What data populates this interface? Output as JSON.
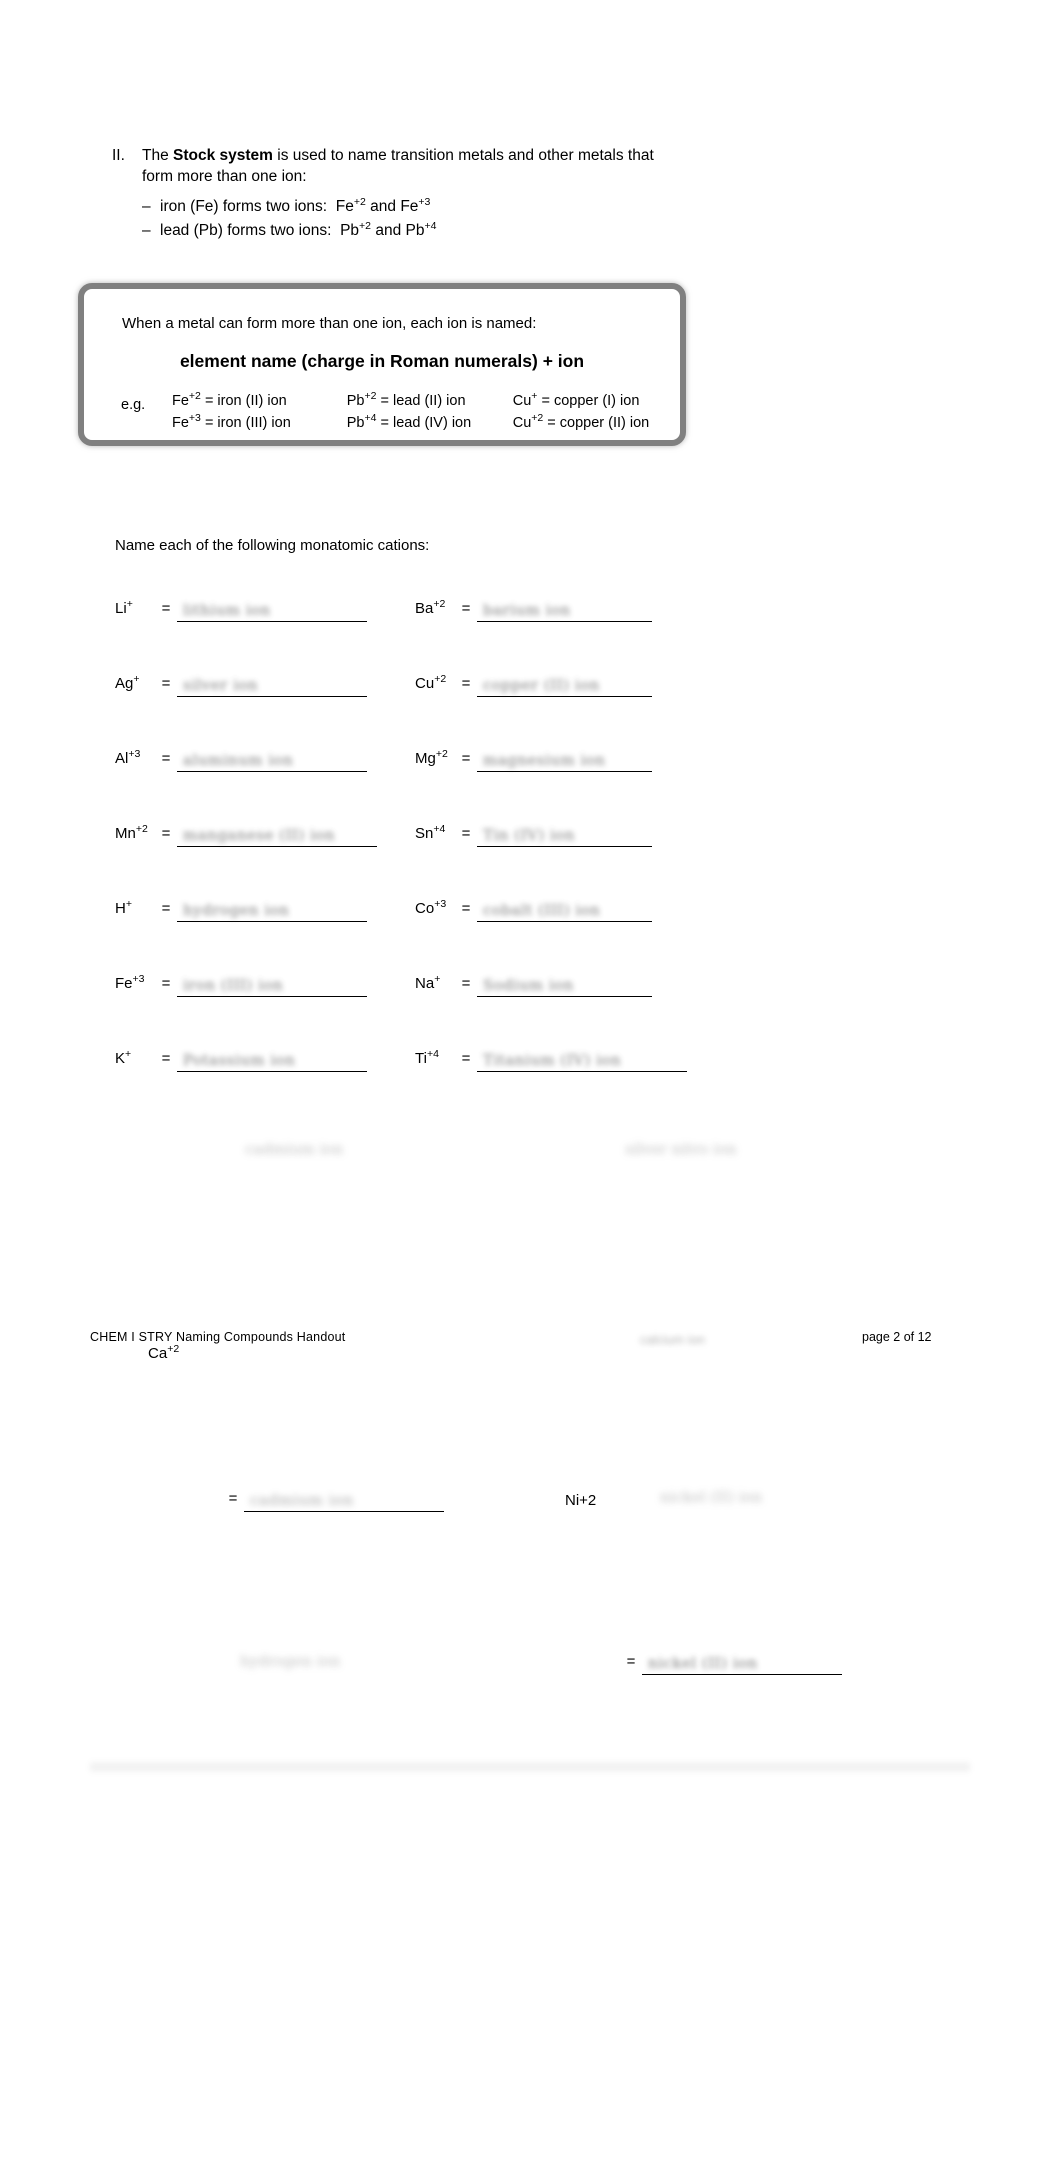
{
  "section": {
    "number": "II.",
    "intro_part1": "The ",
    "intro_bold": "Stock system",
    "intro_part2": " is used to name transition metals and other metals that",
    "intro_line2": "form more than one ion:",
    "bullets": [
      {
        "dash": "–",
        "text": "iron (Fe) forms two ions:",
        "ion1": "Fe",
        "charge1": "+2",
        "conj": "and",
        "ion2": "Fe",
        "charge2": "+3"
      },
      {
        "dash": "–",
        "text": "lead (Pb) forms two ions:",
        "ion1": "Pb",
        "charge1": "+2",
        "conj": "and",
        "ion2": "Pb",
        "charge2": "+4"
      }
    ]
  },
  "rule_box": {
    "line1": "When a metal can form more than one ion, each ion is named:",
    "rule": "element name (charge in Roman numerals) + ion",
    "eg_label": "e.g.",
    "examples": [
      {
        "c1_sym": "Fe",
        "c1_chg": "+2",
        "c1_text": "= iron (II) ion",
        "c2_sym": "Pb",
        "c2_chg": "+2",
        "c2_text": "= lead (II) ion",
        "c3_sym": "Cu",
        "c3_chg": "+",
        "c3_text": "= copper (I) ion"
      },
      {
        "c1_sym": "Fe",
        "c1_chg": "+3",
        "c1_text": "= iron (III) ion",
        "c2_sym": "Pb",
        "c2_chg": "+4",
        "c2_text": "= lead (IV) ion",
        "c3_sym": "Cu",
        "c3_chg": "+2",
        "c3_text": "= copper (II) ion"
      }
    ]
  },
  "prompt": "Name each of the following monatomic cations:",
  "answer_rows": [
    {
      "left": {
        "sym": "Li",
        "chg": "+",
        "eq": "=",
        "answer": "lithium  ion"
      },
      "right": {
        "sym": "Ba",
        "chg": "+2",
        "eq": "=",
        "answer": "barium  ion"
      }
    },
    {
      "left": {
        "sym": "Ag",
        "chg": "+",
        "eq": "=",
        "answer": "silver  ion"
      },
      "right": {
        "sym": "Cu",
        "chg": "+2",
        "eq": "=",
        "answer": "copper (II) ion"
      }
    },
    {
      "left": {
        "sym": "Al",
        "chg": "+3",
        "eq": "=",
        "answer": "aluminum  ion"
      },
      "right": {
        "sym": "Mg",
        "chg": "+2",
        "eq": "=",
        "answer": "magnesium  ion"
      }
    },
    {
      "left": {
        "sym": "Mn",
        "chg": "+2",
        "eq": "=",
        "answer": "manganese (II) ion"
      },
      "right": {
        "sym": "Sn",
        "chg": "+4",
        "eq": "=",
        "answer": "Tin (IV) ion"
      }
    },
    {
      "left": {
        "sym": "H",
        "chg": "+",
        "eq": "=",
        "answer": "hydrogen  ion"
      },
      "right": {
        "sym": "Co",
        "chg": "+3",
        "eq": "=",
        "answer": "cobalt (III) ion"
      }
    },
    {
      "left": {
        "sym": "Fe",
        "chg": "+3",
        "eq": "=",
        "answer": "iron (III) ion"
      },
      "right": {
        "sym": "Na",
        "chg": "+",
        "eq": "=",
        "answer": "Sodium  ion"
      }
    },
    {
      "left": {
        "sym": "K",
        "chg": "+",
        "eq": "=",
        "answer": "Potassium  ion"
      },
      "right": {
        "sym": "Ti",
        "chg": "+4",
        "eq": "=",
        "answer": "Titanium (IV) ion"
      }
    }
  ],
  "ghost_row": {
    "left": "cadmium  ion",
    "right": "silver  nitro  ion"
  },
  "footer": {
    "left": "CHEM I STRY Naming Compounds Handout",
    "right": "page 2 of 12",
    "smudge": "calcium  ion"
  },
  "stray": {
    "ca_sym": "Ca",
    "ca_chg": "+2",
    "ni_label": "Ni+2",
    "ni_answer": "nickel (II) ion",
    "eq": "=",
    "blank_answer": "cadmium  ion",
    "lower_left_ghost": "hydrogen  ion",
    "lower_right_answer": "nickel (II) ion"
  }
}
